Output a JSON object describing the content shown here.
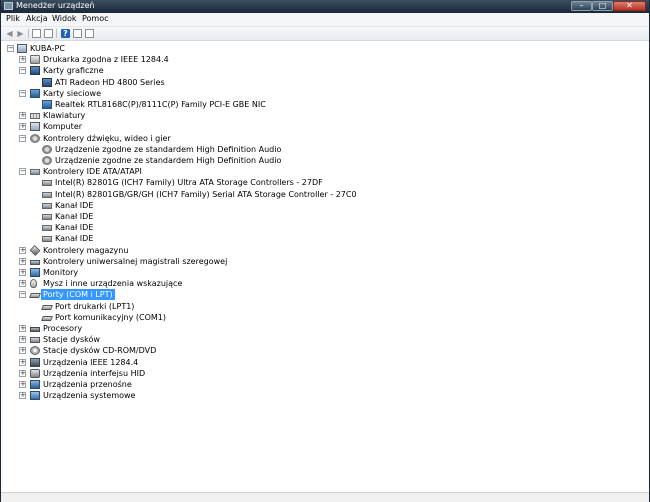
{
  "window": {
    "title": "Menedżer urządzeń",
    "controls": {
      "minimize": "–",
      "maximize": "□",
      "close": "✕"
    }
  },
  "menu": [
    "Plik",
    "Akcja",
    "Widok",
    "Pomoc"
  ],
  "toolbar": {
    "back": "◀",
    "forward": "▶",
    "help": "?"
  },
  "tree": {
    "root": "KUBA-PC",
    "categories": [
      {
        "label": "Drukarka zgodna z IEEE 1284.4",
        "icon": "printer-icon",
        "expanded": false
      },
      {
        "label": "Karty graficzne",
        "icon": "display-adapter-icon",
        "expanded": true,
        "children": [
          "ATI Radeon HD 4800 Series"
        ]
      },
      {
        "label": "Karty sieciowe",
        "icon": "network-adapter-icon",
        "expanded": true,
        "children": [
          "Realtek RTL8168C(P)/8111C(P) Family PCI-E GBE NIC"
        ]
      },
      {
        "label": "Klawiatury",
        "icon": "keyboard-icon",
        "expanded": false
      },
      {
        "label": "Komputer",
        "icon": "computer-icon",
        "expanded": false
      },
      {
        "label": "Kontrolery dźwięku, wideo i gier",
        "icon": "speaker-icon",
        "expanded": true,
        "children": [
          "Urządzenie zgodne ze standardem High Definition Audio",
          "Urządzenie zgodne ze standardem High Definition Audio"
        ]
      },
      {
        "label": "Kontrolery IDE ATA/ATAPI",
        "icon": "ide-controller-icon",
        "expanded": true,
        "children": [
          "Intel(R) 82801G (ICH7 Family) Ultra ATA Storage Controllers - 27DF",
          "Intel(R) 82801GB/GR/GH (ICH7 Family) Serial ATA Storage Controller - 27C0",
          "Kanał IDE",
          "Kanał IDE",
          "Kanał IDE",
          "Kanał IDE"
        ]
      },
      {
        "label": "Kontrolery magazynu",
        "icon": "storage-controller-icon",
        "expanded": false
      },
      {
        "label": "Kontrolery uniwersalnej magistrali szeregowej",
        "icon": "usb-controller-icon",
        "expanded": false
      },
      {
        "label": "Monitory",
        "icon": "monitor-icon",
        "expanded": false
      },
      {
        "label": "Mysz i inne urządzenia wskazujące",
        "icon": "mouse-icon",
        "expanded": false
      },
      {
        "label": "Porty (COM i LPT)",
        "icon": "port-icon",
        "expanded": true,
        "selected": true,
        "children": [
          "Port drukarki (LPT1)",
          "Port komunikacyjny (COM1)"
        ]
      },
      {
        "label": "Procesory",
        "icon": "processor-icon",
        "expanded": false
      },
      {
        "label": "Stacje dysków",
        "icon": "disk-drive-icon",
        "expanded": false
      },
      {
        "label": "Stacje dysków CD-ROM/DVD",
        "icon": "cdrom-icon",
        "expanded": false
      },
      {
        "label": "Urządzenia IEEE 1284.4",
        "icon": "ieee1284-icon",
        "expanded": false
      },
      {
        "label": "Urządzenia interfejsu HID",
        "icon": "hid-icon",
        "expanded": false
      },
      {
        "label": "Urządzenia przenośne",
        "icon": "portable-device-icon",
        "expanded": false
      },
      {
        "label": "Urządzenia systemowe",
        "icon": "system-device-icon",
        "expanded": false
      }
    ]
  }
}
